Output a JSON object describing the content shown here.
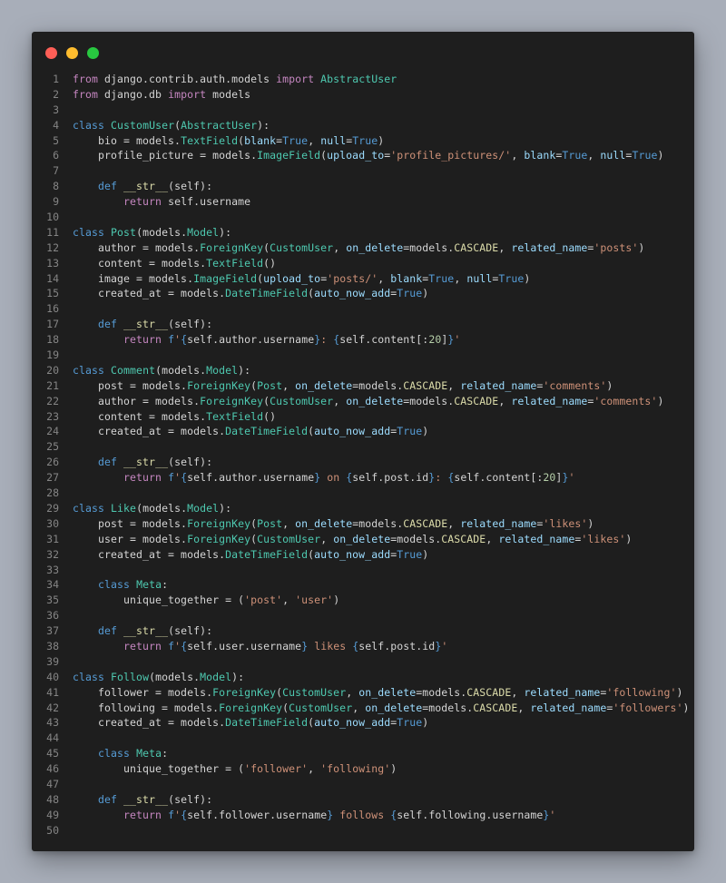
{
  "window": {
    "controls": {
      "close_color": "#ff5f57",
      "minimize_color": "#febc2e",
      "maximize_color": "#28c840"
    }
  },
  "editor": {
    "language": "python",
    "lines": [
      [
        [
          "t-ctl",
          "from"
        ],
        [
          "t-txt",
          " django.contrib.auth.models "
        ],
        [
          "t-ctl",
          "import"
        ],
        [
          "t-txt",
          " "
        ],
        [
          "t-cls",
          "AbstractUser"
        ]
      ],
      [
        [
          "t-ctl",
          "from"
        ],
        [
          "t-txt",
          " django.db "
        ],
        [
          "t-ctl",
          "import"
        ],
        [
          "t-txt",
          " models"
        ]
      ],
      [],
      [
        [
          "t-kw",
          "class"
        ],
        [
          "t-txt",
          " "
        ],
        [
          "t-cls",
          "CustomUser"
        ],
        [
          "t-txt",
          "("
        ],
        [
          "t-cls",
          "AbstractUser"
        ],
        [
          "t-txt",
          "):"
        ]
      ],
      [
        [
          "t-txt",
          "    bio = models."
        ],
        [
          "t-cls",
          "TextField"
        ],
        [
          "t-txt",
          "("
        ],
        [
          "t-var",
          "blank"
        ],
        [
          "t-txt",
          "="
        ],
        [
          "t-kw",
          "True"
        ],
        [
          "t-txt",
          ", "
        ],
        [
          "t-var",
          "null"
        ],
        [
          "t-txt",
          "="
        ],
        [
          "t-kw",
          "True"
        ],
        [
          "t-txt",
          ")"
        ]
      ],
      [
        [
          "t-txt",
          "    profile_picture = models."
        ],
        [
          "t-cls",
          "ImageField"
        ],
        [
          "t-txt",
          "("
        ],
        [
          "t-var",
          "upload_to"
        ],
        [
          "t-txt",
          "="
        ],
        [
          "t-str",
          "'profile_pictures/'"
        ],
        [
          "t-txt",
          ", "
        ],
        [
          "t-var",
          "blank"
        ],
        [
          "t-txt",
          "="
        ],
        [
          "t-kw",
          "True"
        ],
        [
          "t-txt",
          ", "
        ],
        [
          "t-var",
          "null"
        ],
        [
          "t-txt",
          "="
        ],
        [
          "t-kw",
          "True"
        ],
        [
          "t-txt",
          ")"
        ]
      ],
      [],
      [
        [
          "t-txt",
          "    "
        ],
        [
          "t-kw",
          "def"
        ],
        [
          "t-txt",
          " "
        ],
        [
          "t-fn",
          "__str__"
        ],
        [
          "t-txt",
          "(self):"
        ]
      ],
      [
        [
          "t-txt",
          "        "
        ],
        [
          "t-ctl",
          "return"
        ],
        [
          "t-txt",
          " self.username"
        ]
      ],
      [],
      [
        [
          "t-kw",
          "class"
        ],
        [
          "t-txt",
          " "
        ],
        [
          "t-cls",
          "Post"
        ],
        [
          "t-txt",
          "(models."
        ],
        [
          "t-cls",
          "Model"
        ],
        [
          "t-txt",
          "):"
        ]
      ],
      [
        [
          "t-txt",
          "    author = models."
        ],
        [
          "t-cls",
          "ForeignKey"
        ],
        [
          "t-txt",
          "("
        ],
        [
          "t-cls",
          "CustomUser"
        ],
        [
          "t-txt",
          ", "
        ],
        [
          "t-var",
          "on_delete"
        ],
        [
          "t-txt",
          "=models."
        ],
        [
          "t-fn",
          "CASCADE"
        ],
        [
          "t-txt",
          ", "
        ],
        [
          "t-var",
          "related_name"
        ],
        [
          "t-txt",
          "="
        ],
        [
          "t-str",
          "'posts'"
        ],
        [
          "t-txt",
          ")"
        ]
      ],
      [
        [
          "t-txt",
          "    content = models."
        ],
        [
          "t-cls",
          "TextField"
        ],
        [
          "t-txt",
          "()"
        ]
      ],
      [
        [
          "t-txt",
          "    image = models."
        ],
        [
          "t-cls",
          "ImageField"
        ],
        [
          "t-txt",
          "("
        ],
        [
          "t-var",
          "upload_to"
        ],
        [
          "t-txt",
          "="
        ],
        [
          "t-str",
          "'posts/'"
        ],
        [
          "t-txt",
          ", "
        ],
        [
          "t-var",
          "blank"
        ],
        [
          "t-txt",
          "="
        ],
        [
          "t-kw",
          "True"
        ],
        [
          "t-txt",
          ", "
        ],
        [
          "t-var",
          "null"
        ],
        [
          "t-txt",
          "="
        ],
        [
          "t-kw",
          "True"
        ],
        [
          "t-txt",
          ")"
        ]
      ],
      [
        [
          "t-txt",
          "    created_at = models."
        ],
        [
          "t-cls",
          "DateTimeField"
        ],
        [
          "t-txt",
          "("
        ],
        [
          "t-var",
          "auto_now_add"
        ],
        [
          "t-txt",
          "="
        ],
        [
          "t-kw",
          "True"
        ],
        [
          "t-txt",
          ")"
        ]
      ],
      [],
      [
        [
          "t-txt",
          "    "
        ],
        [
          "t-kw",
          "def"
        ],
        [
          "t-txt",
          " "
        ],
        [
          "t-fn",
          "__str__"
        ],
        [
          "t-txt",
          "(self):"
        ]
      ],
      [
        [
          "t-txt",
          "        "
        ],
        [
          "t-ctl",
          "return"
        ],
        [
          "t-txt",
          " "
        ],
        [
          "t-kw",
          "f"
        ],
        [
          "t-str",
          "'"
        ],
        [
          "t-kw",
          "{"
        ],
        [
          "t-txt",
          "self.author.username"
        ],
        [
          "t-kw",
          "}"
        ],
        [
          "t-str",
          ": "
        ],
        [
          "t-kw",
          "{"
        ],
        [
          "t-txt",
          "self.content[:"
        ],
        [
          "t-num",
          "20"
        ],
        [
          "t-txt",
          "]"
        ],
        [
          "t-kw",
          "}"
        ],
        [
          "t-str",
          "'"
        ]
      ],
      [],
      [
        [
          "t-kw",
          "class"
        ],
        [
          "t-txt",
          " "
        ],
        [
          "t-cls",
          "Comment"
        ],
        [
          "t-txt",
          "(models."
        ],
        [
          "t-cls",
          "Model"
        ],
        [
          "t-txt",
          "):"
        ]
      ],
      [
        [
          "t-txt",
          "    post = models."
        ],
        [
          "t-cls",
          "ForeignKey"
        ],
        [
          "t-txt",
          "("
        ],
        [
          "t-cls",
          "Post"
        ],
        [
          "t-txt",
          ", "
        ],
        [
          "t-var",
          "on_delete"
        ],
        [
          "t-txt",
          "=models."
        ],
        [
          "t-fn",
          "CASCADE"
        ],
        [
          "t-txt",
          ", "
        ],
        [
          "t-var",
          "related_name"
        ],
        [
          "t-txt",
          "="
        ],
        [
          "t-str",
          "'comments'"
        ],
        [
          "t-txt",
          ")"
        ]
      ],
      [
        [
          "t-txt",
          "    author = models."
        ],
        [
          "t-cls",
          "ForeignKey"
        ],
        [
          "t-txt",
          "("
        ],
        [
          "t-cls",
          "CustomUser"
        ],
        [
          "t-txt",
          ", "
        ],
        [
          "t-var",
          "on_delete"
        ],
        [
          "t-txt",
          "=models."
        ],
        [
          "t-fn",
          "CASCADE"
        ],
        [
          "t-txt",
          ", "
        ],
        [
          "t-var",
          "related_name"
        ],
        [
          "t-txt",
          "="
        ],
        [
          "t-str",
          "'comments'"
        ],
        [
          "t-txt",
          ")"
        ]
      ],
      [
        [
          "t-txt",
          "    content = models."
        ],
        [
          "t-cls",
          "TextField"
        ],
        [
          "t-txt",
          "()"
        ]
      ],
      [
        [
          "t-txt",
          "    created_at = models."
        ],
        [
          "t-cls",
          "DateTimeField"
        ],
        [
          "t-txt",
          "("
        ],
        [
          "t-var",
          "auto_now_add"
        ],
        [
          "t-txt",
          "="
        ],
        [
          "t-kw",
          "True"
        ],
        [
          "t-txt",
          ")"
        ]
      ],
      [],
      [
        [
          "t-txt",
          "    "
        ],
        [
          "t-kw",
          "def"
        ],
        [
          "t-txt",
          " "
        ],
        [
          "t-fn",
          "__str__"
        ],
        [
          "t-txt",
          "(self):"
        ]
      ],
      [
        [
          "t-txt",
          "        "
        ],
        [
          "t-ctl",
          "return"
        ],
        [
          "t-txt",
          " "
        ],
        [
          "t-kw",
          "f"
        ],
        [
          "t-str",
          "'"
        ],
        [
          "t-kw",
          "{"
        ],
        [
          "t-txt",
          "self.author.username"
        ],
        [
          "t-kw",
          "}"
        ],
        [
          "t-str",
          " on "
        ],
        [
          "t-kw",
          "{"
        ],
        [
          "t-txt",
          "self.post.id"
        ],
        [
          "t-kw",
          "}"
        ],
        [
          "t-str",
          ": "
        ],
        [
          "t-kw",
          "{"
        ],
        [
          "t-txt",
          "self.content[:"
        ],
        [
          "t-num",
          "20"
        ],
        [
          "t-txt",
          "]"
        ],
        [
          "t-kw",
          "}"
        ],
        [
          "t-str",
          "'"
        ]
      ],
      [],
      [
        [
          "t-kw",
          "class"
        ],
        [
          "t-txt",
          " "
        ],
        [
          "t-cls",
          "Like"
        ],
        [
          "t-txt",
          "(models."
        ],
        [
          "t-cls",
          "Model"
        ],
        [
          "t-txt",
          "):"
        ]
      ],
      [
        [
          "t-txt",
          "    post = models."
        ],
        [
          "t-cls",
          "ForeignKey"
        ],
        [
          "t-txt",
          "("
        ],
        [
          "t-cls",
          "Post"
        ],
        [
          "t-txt",
          ", "
        ],
        [
          "t-var",
          "on_delete"
        ],
        [
          "t-txt",
          "=models."
        ],
        [
          "t-fn",
          "CASCADE"
        ],
        [
          "t-txt",
          ", "
        ],
        [
          "t-var",
          "related_name"
        ],
        [
          "t-txt",
          "="
        ],
        [
          "t-str",
          "'likes'"
        ],
        [
          "t-txt",
          ")"
        ]
      ],
      [
        [
          "t-txt",
          "    user = models."
        ],
        [
          "t-cls",
          "ForeignKey"
        ],
        [
          "t-txt",
          "("
        ],
        [
          "t-cls",
          "CustomUser"
        ],
        [
          "t-txt",
          ", "
        ],
        [
          "t-var",
          "on_delete"
        ],
        [
          "t-txt",
          "=models."
        ],
        [
          "t-fn",
          "CASCADE"
        ],
        [
          "t-txt",
          ", "
        ],
        [
          "t-var",
          "related_name"
        ],
        [
          "t-txt",
          "="
        ],
        [
          "t-str",
          "'likes'"
        ],
        [
          "t-txt",
          ")"
        ]
      ],
      [
        [
          "t-txt",
          "    created_at = models."
        ],
        [
          "t-cls",
          "DateTimeField"
        ],
        [
          "t-txt",
          "("
        ],
        [
          "t-var",
          "auto_now_add"
        ],
        [
          "t-txt",
          "="
        ],
        [
          "t-kw",
          "True"
        ],
        [
          "t-txt",
          ")"
        ]
      ],
      [],
      [
        [
          "t-txt",
          "    "
        ],
        [
          "t-kw",
          "class"
        ],
        [
          "t-txt",
          " "
        ],
        [
          "t-cls",
          "Meta"
        ],
        [
          "t-txt",
          ":"
        ]
      ],
      [
        [
          "t-txt",
          "        unique_together = ("
        ],
        [
          "t-str",
          "'post'"
        ],
        [
          "t-txt",
          ", "
        ],
        [
          "t-str",
          "'user'"
        ],
        [
          "t-txt",
          ")"
        ]
      ],
      [],
      [
        [
          "t-txt",
          "    "
        ],
        [
          "t-kw",
          "def"
        ],
        [
          "t-txt",
          " "
        ],
        [
          "t-fn",
          "__str__"
        ],
        [
          "t-txt",
          "(self):"
        ]
      ],
      [
        [
          "t-txt",
          "        "
        ],
        [
          "t-ctl",
          "return"
        ],
        [
          "t-txt",
          " "
        ],
        [
          "t-kw",
          "f"
        ],
        [
          "t-str",
          "'"
        ],
        [
          "t-kw",
          "{"
        ],
        [
          "t-txt",
          "self.user.username"
        ],
        [
          "t-kw",
          "}"
        ],
        [
          "t-str",
          " likes "
        ],
        [
          "t-kw",
          "{"
        ],
        [
          "t-txt",
          "self.post.id"
        ],
        [
          "t-kw",
          "}"
        ],
        [
          "t-str",
          "'"
        ]
      ],
      [],
      [
        [
          "t-kw",
          "class"
        ],
        [
          "t-txt",
          " "
        ],
        [
          "t-cls",
          "Follow"
        ],
        [
          "t-txt",
          "(models."
        ],
        [
          "t-cls",
          "Model"
        ],
        [
          "t-txt",
          "):"
        ]
      ],
      [
        [
          "t-txt",
          "    follower = models."
        ],
        [
          "t-cls",
          "ForeignKey"
        ],
        [
          "t-txt",
          "("
        ],
        [
          "t-cls",
          "CustomUser"
        ],
        [
          "t-txt",
          ", "
        ],
        [
          "t-var",
          "on_delete"
        ],
        [
          "t-txt",
          "=models."
        ],
        [
          "t-fn",
          "CASCADE"
        ],
        [
          "t-txt",
          ", "
        ],
        [
          "t-var",
          "related_name"
        ],
        [
          "t-txt",
          "="
        ],
        [
          "t-str",
          "'following'"
        ],
        [
          "t-txt",
          ")"
        ]
      ],
      [
        [
          "t-txt",
          "    following = models."
        ],
        [
          "t-cls",
          "ForeignKey"
        ],
        [
          "t-txt",
          "("
        ],
        [
          "t-cls",
          "CustomUser"
        ],
        [
          "t-txt",
          ", "
        ],
        [
          "t-var",
          "on_delete"
        ],
        [
          "t-txt",
          "=models."
        ],
        [
          "t-fn",
          "CASCADE"
        ],
        [
          "t-txt",
          ", "
        ],
        [
          "t-var",
          "related_name"
        ],
        [
          "t-txt",
          "="
        ],
        [
          "t-str",
          "'followers'"
        ],
        [
          "t-txt",
          ")"
        ]
      ],
      [
        [
          "t-txt",
          "    created_at = models."
        ],
        [
          "t-cls",
          "DateTimeField"
        ],
        [
          "t-txt",
          "("
        ],
        [
          "t-var",
          "auto_now_add"
        ],
        [
          "t-txt",
          "="
        ],
        [
          "t-kw",
          "True"
        ],
        [
          "t-txt",
          ")"
        ]
      ],
      [],
      [
        [
          "t-txt",
          "    "
        ],
        [
          "t-kw",
          "class"
        ],
        [
          "t-txt",
          " "
        ],
        [
          "t-cls",
          "Meta"
        ],
        [
          "t-txt",
          ":"
        ]
      ],
      [
        [
          "t-txt",
          "        unique_together = ("
        ],
        [
          "t-str",
          "'follower'"
        ],
        [
          "t-txt",
          ", "
        ],
        [
          "t-str",
          "'following'"
        ],
        [
          "t-txt",
          ")"
        ]
      ],
      [],
      [
        [
          "t-txt",
          "    "
        ],
        [
          "t-kw",
          "def"
        ],
        [
          "t-txt",
          " "
        ],
        [
          "t-fn",
          "__str__"
        ],
        [
          "t-txt",
          "(self):"
        ]
      ],
      [
        [
          "t-txt",
          "        "
        ],
        [
          "t-ctl",
          "return"
        ],
        [
          "t-txt",
          " "
        ],
        [
          "t-kw",
          "f"
        ],
        [
          "t-str",
          "'"
        ],
        [
          "t-kw",
          "{"
        ],
        [
          "t-txt",
          "self.follower.username"
        ],
        [
          "t-kw",
          "}"
        ],
        [
          "t-str",
          " follows "
        ],
        [
          "t-kw",
          "{"
        ],
        [
          "t-txt",
          "self.following.username"
        ],
        [
          "t-kw",
          "}"
        ],
        [
          "t-str",
          "'"
        ]
      ],
      []
    ]
  }
}
